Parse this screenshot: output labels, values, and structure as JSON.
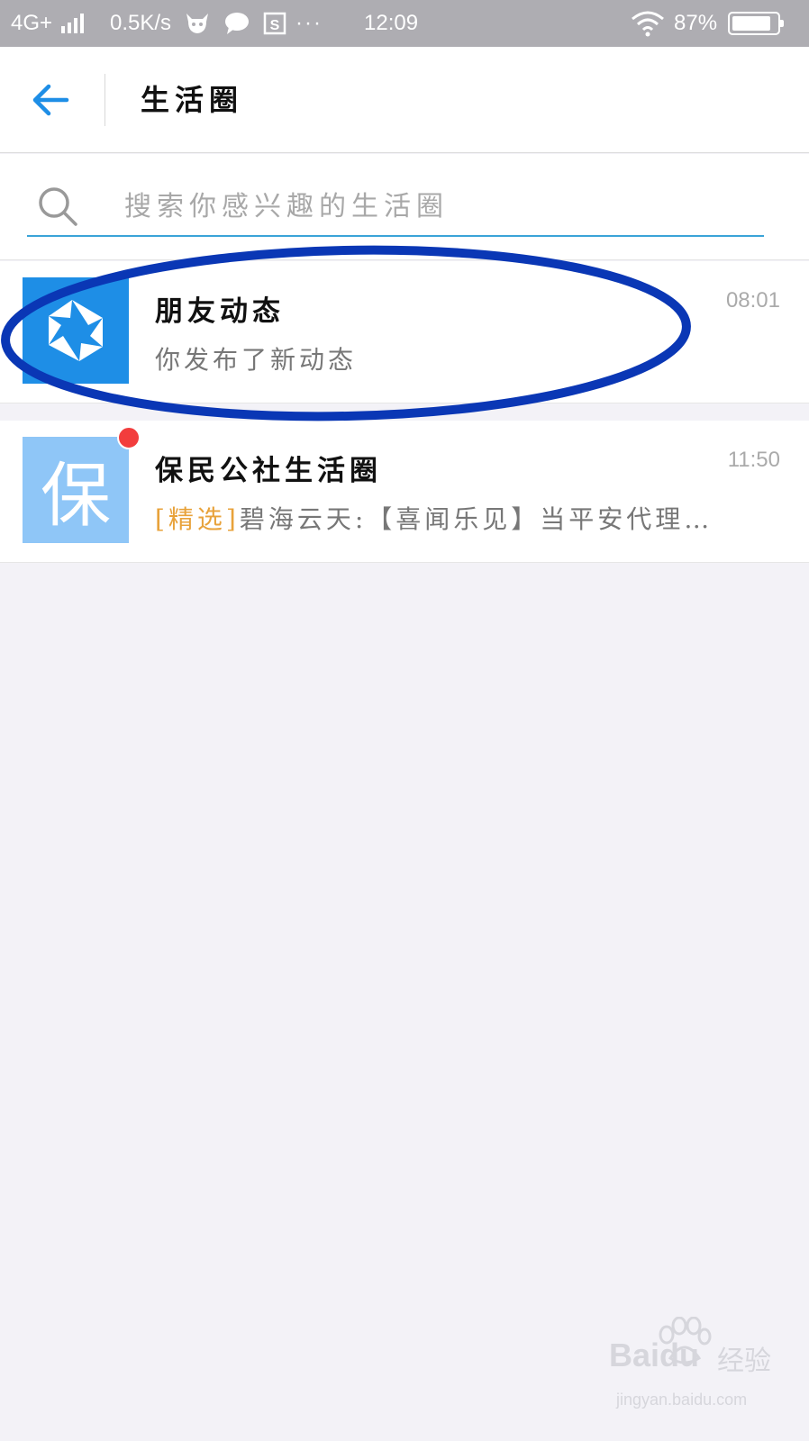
{
  "status_bar": {
    "network": "4G+",
    "speed": "0.5K/s",
    "more": "···",
    "time": "12:09",
    "battery": "87%",
    "battery_level": 0.87
  },
  "header": {
    "title": "生活圈",
    "accent_color": "#1e8ee6"
  },
  "search": {
    "placeholder": "搜索你感兴趣的生活圈"
  },
  "list": [
    {
      "title": "朋友动态",
      "subtitle": "你发布了新动态",
      "time": "08:01",
      "avatar_icon": "aperture-icon",
      "avatar_color": "#1e8ee6"
    },
    {
      "title": "保民公社生活圈",
      "tag": "[精选]",
      "subtitle": "碧海云天:【喜闻乐见】当平安代理…",
      "time": "11:50",
      "avatar_char": "保",
      "avatar_color": "#8fc6f7",
      "unread": true
    }
  ],
  "annotation": {
    "color": "#0a37b5"
  },
  "watermark": {
    "brand": "Baidu",
    "suffix": "经验",
    "url": "jingyan.baidu.com"
  }
}
